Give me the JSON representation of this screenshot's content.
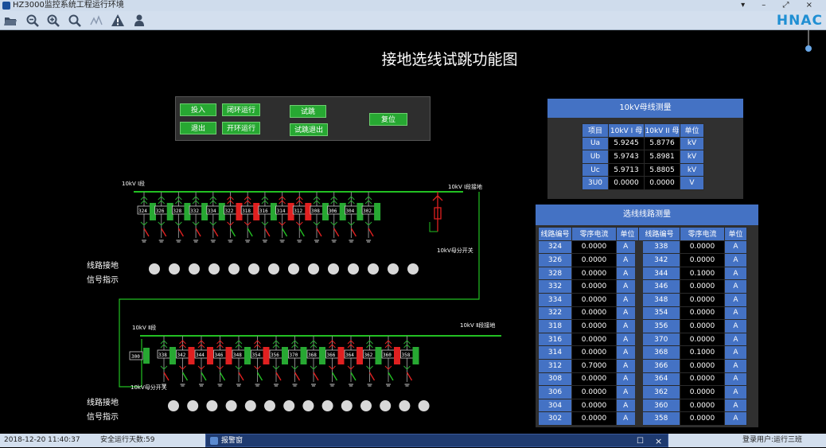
{
  "app": {
    "title": "HZ3000监控系统工程运行环境",
    "logo": "HNAC",
    "win_controls": "▾ – ⤢ ×"
  },
  "toolbar": {
    "icons": [
      "open-folder-icon",
      "zoom-out-icon",
      "zoom-in-icon",
      "zoom-fit-icon",
      "signal-icon",
      "warning-icon",
      "user-icon"
    ]
  },
  "colors": {
    "accent": "#4472c4",
    "energized": "#27a832",
    "fault": "#e02020",
    "busbar": "#22c022"
  },
  "page_title": "接地选线试跳功能图",
  "controls": {
    "btn1": "投入",
    "btn2": "退出",
    "btn3": "闭环运行",
    "btn4": "开环运行",
    "btn5": "试跳",
    "btn6": "试跳退出",
    "btn7": "复位"
  },
  "bus_table": {
    "title": "10kV母线测量",
    "headers": [
      "项目",
      "10kV I 母",
      "10kV II 母",
      "单位"
    ],
    "rows": [
      [
        "Ua",
        "5.9245",
        "5.8776",
        "kV"
      ],
      [
        "Ub",
        "5.9743",
        "5.8981",
        "kV"
      ],
      [
        "Uc",
        "5.9713",
        "5.8805",
        "kV"
      ],
      [
        "3U0",
        "0.0000",
        "0.0000",
        "V"
      ]
    ]
  },
  "line_table": {
    "title": "选线线路测量",
    "headers": [
      "线路编号",
      "零序电流",
      "单位",
      "线路编号",
      "零序电流",
      "单位"
    ],
    "rows": [
      [
        "324",
        "0.0000",
        "A",
        "338",
        "0.0000",
        "A"
      ],
      [
        "326",
        "0.0000",
        "A",
        "342",
        "0.0000",
        "A"
      ],
      [
        "328",
        "0.0000",
        "A",
        "344",
        "0.1000",
        "A"
      ],
      [
        "332",
        "0.0000",
        "A",
        "346",
        "0.0000",
        "A"
      ],
      [
        "334",
        "0.0000",
        "A",
        "348",
        "0.0000",
        "A"
      ],
      [
        "322",
        "0.0000",
        "A",
        "354",
        "0.0000",
        "A"
      ],
      [
        "318",
        "0.0000",
        "A",
        "356",
        "0.0000",
        "A"
      ],
      [
        "316",
        "0.0000",
        "A",
        "370",
        "0.0000",
        "A"
      ],
      [
        "314",
        "0.0000",
        "A",
        "368",
        "0.1000",
        "A"
      ],
      [
        "312",
        "0.7000",
        "A",
        "366",
        "0.0000",
        "A"
      ],
      [
        "308",
        "0.0000",
        "A",
        "364",
        "0.0000",
        "A"
      ],
      [
        "306",
        "0.0000",
        "A",
        "362",
        "0.0000",
        "A"
      ],
      [
        "304",
        "0.0000",
        "A",
        "360",
        "0.0000",
        "A"
      ],
      [
        "302",
        "0.0000",
        "A",
        "358",
        "0.0000",
        "A"
      ]
    ]
  },
  "bus1": {
    "label": "10kV Ⅰ段",
    "ground_label": "10kV Ⅰ段接地",
    "coupler_label": "10kV母分开关",
    "signal_label_1": "线路接地",
    "signal_label_2": "信号指示",
    "feeders": [
      {
        "id": "324",
        "state": "on"
      },
      {
        "id": "326",
        "state": "on"
      },
      {
        "id": "328",
        "state": "on"
      },
      {
        "id": "332",
        "state": "on"
      },
      {
        "id": "334",
        "state": "on"
      },
      {
        "id": "322",
        "state": "off"
      },
      {
        "id": "318",
        "state": "off"
      },
      {
        "id": "316",
        "state": "on"
      },
      {
        "id": "314",
        "state": "off"
      },
      {
        "id": "312",
        "state": "off"
      },
      {
        "id": "308",
        "state": "on"
      },
      {
        "id": "306",
        "state": "on"
      },
      {
        "id": "304",
        "state": "on"
      },
      {
        "id": "302",
        "state": "on"
      }
    ]
  },
  "bus2": {
    "label": "10kV Ⅱ段",
    "ground_label": "10kV Ⅱ段接地",
    "coupler_label": "10kV母分开关",
    "coupler_id": "300",
    "signal_label_1": "线路接地",
    "signal_label_2": "信号指示",
    "feeders": [
      {
        "id": "338",
        "state": "on"
      },
      {
        "id": "342",
        "state": "off"
      },
      {
        "id": "344",
        "state": "off"
      },
      {
        "id": "346",
        "state": "off"
      },
      {
        "id": "348",
        "state": "on"
      },
      {
        "id": "354",
        "state": "off"
      },
      {
        "id": "356",
        "state": "on"
      },
      {
        "id": "370",
        "state": "on"
      },
      {
        "id": "368",
        "state": "on"
      },
      {
        "id": "366",
        "state": "off"
      },
      {
        "id": "364",
        "state": "off"
      },
      {
        "id": "362",
        "state": "on"
      },
      {
        "id": "360",
        "state": "off"
      },
      {
        "id": "358",
        "state": "on"
      }
    ]
  },
  "status": {
    "datetime": "2018-12-20  11:40:37",
    "safe_days": "安全运行天数:59",
    "alarm_window": "报警窗",
    "user": "登录用户:运行三班"
  }
}
